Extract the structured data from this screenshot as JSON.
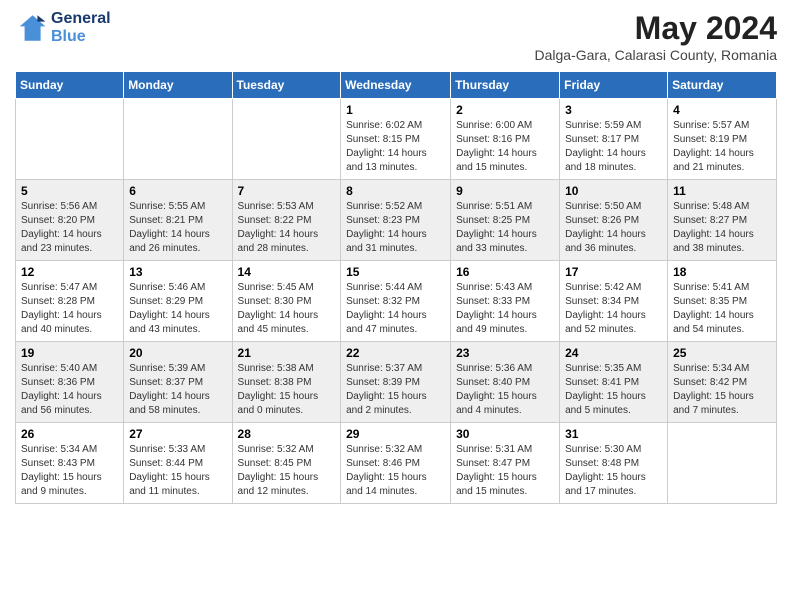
{
  "header": {
    "logo_line1": "General",
    "logo_line2": "Blue",
    "month_title": "May 2024",
    "location": "Dalga-Gara, Calarasi County, Romania"
  },
  "weekdays": [
    "Sunday",
    "Monday",
    "Tuesday",
    "Wednesday",
    "Thursday",
    "Friday",
    "Saturday"
  ],
  "weeks": [
    [
      {
        "day": "",
        "info": ""
      },
      {
        "day": "",
        "info": ""
      },
      {
        "day": "",
        "info": ""
      },
      {
        "day": "1",
        "info": "Sunrise: 6:02 AM\nSunset: 8:15 PM\nDaylight: 14 hours and 13 minutes."
      },
      {
        "day": "2",
        "info": "Sunrise: 6:00 AM\nSunset: 8:16 PM\nDaylight: 14 hours and 15 minutes."
      },
      {
        "day": "3",
        "info": "Sunrise: 5:59 AM\nSunset: 8:17 PM\nDaylight: 14 hours and 18 minutes."
      },
      {
        "day": "4",
        "info": "Sunrise: 5:57 AM\nSunset: 8:19 PM\nDaylight: 14 hours and 21 minutes."
      }
    ],
    [
      {
        "day": "5",
        "info": "Sunrise: 5:56 AM\nSunset: 8:20 PM\nDaylight: 14 hours and 23 minutes."
      },
      {
        "day": "6",
        "info": "Sunrise: 5:55 AM\nSunset: 8:21 PM\nDaylight: 14 hours and 26 minutes."
      },
      {
        "day": "7",
        "info": "Sunrise: 5:53 AM\nSunset: 8:22 PM\nDaylight: 14 hours and 28 minutes."
      },
      {
        "day": "8",
        "info": "Sunrise: 5:52 AM\nSunset: 8:23 PM\nDaylight: 14 hours and 31 minutes."
      },
      {
        "day": "9",
        "info": "Sunrise: 5:51 AM\nSunset: 8:25 PM\nDaylight: 14 hours and 33 minutes."
      },
      {
        "day": "10",
        "info": "Sunrise: 5:50 AM\nSunset: 8:26 PM\nDaylight: 14 hours and 36 minutes."
      },
      {
        "day": "11",
        "info": "Sunrise: 5:48 AM\nSunset: 8:27 PM\nDaylight: 14 hours and 38 minutes."
      }
    ],
    [
      {
        "day": "12",
        "info": "Sunrise: 5:47 AM\nSunset: 8:28 PM\nDaylight: 14 hours and 40 minutes."
      },
      {
        "day": "13",
        "info": "Sunrise: 5:46 AM\nSunset: 8:29 PM\nDaylight: 14 hours and 43 minutes."
      },
      {
        "day": "14",
        "info": "Sunrise: 5:45 AM\nSunset: 8:30 PM\nDaylight: 14 hours and 45 minutes."
      },
      {
        "day": "15",
        "info": "Sunrise: 5:44 AM\nSunset: 8:32 PM\nDaylight: 14 hours and 47 minutes."
      },
      {
        "day": "16",
        "info": "Sunrise: 5:43 AM\nSunset: 8:33 PM\nDaylight: 14 hours and 49 minutes."
      },
      {
        "day": "17",
        "info": "Sunrise: 5:42 AM\nSunset: 8:34 PM\nDaylight: 14 hours and 52 minutes."
      },
      {
        "day": "18",
        "info": "Sunrise: 5:41 AM\nSunset: 8:35 PM\nDaylight: 14 hours and 54 minutes."
      }
    ],
    [
      {
        "day": "19",
        "info": "Sunrise: 5:40 AM\nSunset: 8:36 PM\nDaylight: 14 hours and 56 minutes."
      },
      {
        "day": "20",
        "info": "Sunrise: 5:39 AM\nSunset: 8:37 PM\nDaylight: 14 hours and 58 minutes."
      },
      {
        "day": "21",
        "info": "Sunrise: 5:38 AM\nSunset: 8:38 PM\nDaylight: 15 hours and 0 minutes."
      },
      {
        "day": "22",
        "info": "Sunrise: 5:37 AM\nSunset: 8:39 PM\nDaylight: 15 hours and 2 minutes."
      },
      {
        "day": "23",
        "info": "Sunrise: 5:36 AM\nSunset: 8:40 PM\nDaylight: 15 hours and 4 minutes."
      },
      {
        "day": "24",
        "info": "Sunrise: 5:35 AM\nSunset: 8:41 PM\nDaylight: 15 hours and 5 minutes."
      },
      {
        "day": "25",
        "info": "Sunrise: 5:34 AM\nSunset: 8:42 PM\nDaylight: 15 hours and 7 minutes."
      }
    ],
    [
      {
        "day": "26",
        "info": "Sunrise: 5:34 AM\nSunset: 8:43 PM\nDaylight: 15 hours and 9 minutes."
      },
      {
        "day": "27",
        "info": "Sunrise: 5:33 AM\nSunset: 8:44 PM\nDaylight: 15 hours and 11 minutes."
      },
      {
        "day": "28",
        "info": "Sunrise: 5:32 AM\nSunset: 8:45 PM\nDaylight: 15 hours and 12 minutes."
      },
      {
        "day": "29",
        "info": "Sunrise: 5:32 AM\nSunset: 8:46 PM\nDaylight: 15 hours and 14 minutes."
      },
      {
        "day": "30",
        "info": "Sunrise: 5:31 AM\nSunset: 8:47 PM\nDaylight: 15 hours and 15 minutes."
      },
      {
        "day": "31",
        "info": "Sunrise: 5:30 AM\nSunset: 8:48 PM\nDaylight: 15 hours and 17 minutes."
      },
      {
        "day": "",
        "info": ""
      }
    ]
  ]
}
